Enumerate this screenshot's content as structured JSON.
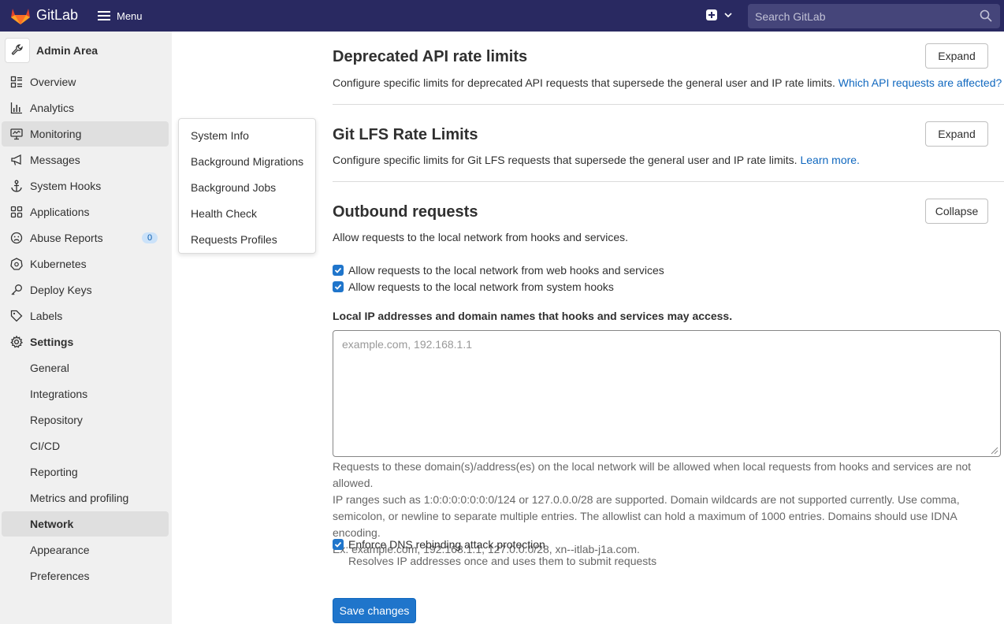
{
  "topbar": {
    "brand": "GitLab",
    "menu_label": "Menu",
    "search_placeholder": "Search GitLab"
  },
  "sidebar": {
    "title": "Admin Area",
    "items": [
      {
        "label": "Overview",
        "icon": "overview-icon"
      },
      {
        "label": "Analytics",
        "icon": "analytics-icon"
      },
      {
        "label": "Monitoring",
        "icon": "monitor-icon",
        "active": true
      },
      {
        "label": "Messages",
        "icon": "megaphone-icon"
      },
      {
        "label": "System Hooks",
        "icon": "anchor-icon"
      },
      {
        "label": "Applications",
        "icon": "grid-icon"
      },
      {
        "label": "Abuse Reports",
        "icon": "abuse-icon",
        "badge": "0"
      },
      {
        "label": "Kubernetes",
        "icon": "kubernetes-icon"
      },
      {
        "label": "Deploy Keys",
        "icon": "key-icon"
      },
      {
        "label": "Labels",
        "icon": "label-icon"
      },
      {
        "label": "Settings",
        "icon": "settings-icon"
      },
      {
        "label": "General"
      },
      {
        "label": "Integrations"
      },
      {
        "label": "Repository"
      },
      {
        "label": "CI/CD"
      },
      {
        "label": "Reporting"
      },
      {
        "label": "Metrics and profiling"
      },
      {
        "label": "Network",
        "active": true
      },
      {
        "label": "Appearance"
      },
      {
        "label": "Preferences"
      }
    ]
  },
  "flyout": {
    "items": [
      "System Info",
      "Background Migrations",
      "Background Jobs",
      "Health Check",
      "Requests Profiles"
    ]
  },
  "sections": {
    "deprecated": {
      "title": "Deprecated API rate limits",
      "desc": "Configure specific limits for deprecated API requests that supersede the general user and IP rate limits.",
      "link": "Which API requests are affected?",
      "button": "Expand"
    },
    "lfs": {
      "title": "Git LFS Rate Limits",
      "desc": "Configure specific limits for Git LFS requests that supersede the general user and IP rate limits.",
      "link": "Learn more.",
      "button": "Expand"
    },
    "outbound": {
      "title": "Outbound requests",
      "desc": "Allow requests to the local network from hooks and services.",
      "button": "Collapse",
      "cb1": "Allow requests to the local network from web hooks and services",
      "cb2": "Allow requests to the local network from system hooks",
      "field_label": "Local IP addresses and domain names that hooks and services may access.",
      "textarea_placeholder": "example.com, 192.168.1.1",
      "help_lines": [
        "Requests to these domain(s)/address(es) on the local network will be allowed when local requests from hooks and services are not allowed.",
        "IP ranges such as 1:0:0:0:0:0:0:0/124 or 127.0.0.0/28 are supported. Domain wildcards are not supported currently. Use comma,",
        "semicolon, or newline to separate multiple entries. The allowlist can hold a maximum of 1000 entries. Domains should use IDNA encoding.",
        "Ex: example.com, 192.168.1.1, 127.0.0.0/28, xn--itlab-j1a.com."
      ],
      "dns_label": "Enforce DNS rebinding attack protection",
      "dns_help": "Resolves IP addresses once and uses them to submit requests",
      "save": "Save changes"
    }
  }
}
